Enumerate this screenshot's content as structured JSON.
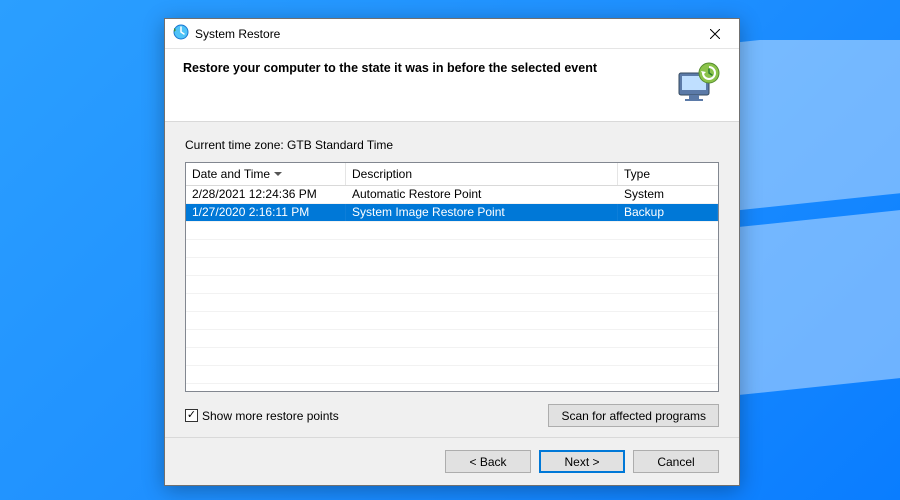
{
  "window": {
    "title": "System Restore"
  },
  "header": {
    "title": "Restore your computer to the state it was in before the selected event"
  },
  "timezone": {
    "label": "Current time zone: GTB Standard Time"
  },
  "table": {
    "columns": {
      "date": "Date and Time",
      "description": "Description",
      "type": "Type"
    },
    "rows": [
      {
        "date": "2/28/2021 12:24:36 PM",
        "description": "Automatic Restore Point",
        "type": "System",
        "selected": false
      },
      {
        "date": "1/27/2020 2:16:11 PM",
        "description": "System Image Restore Point",
        "type": "Backup",
        "selected": true
      }
    ]
  },
  "checkbox": {
    "checked": true,
    "label": "Show more restore points"
  },
  "buttons": {
    "scan": "Scan for affected programs",
    "back": "< Back",
    "next": "Next >",
    "cancel": "Cancel"
  }
}
